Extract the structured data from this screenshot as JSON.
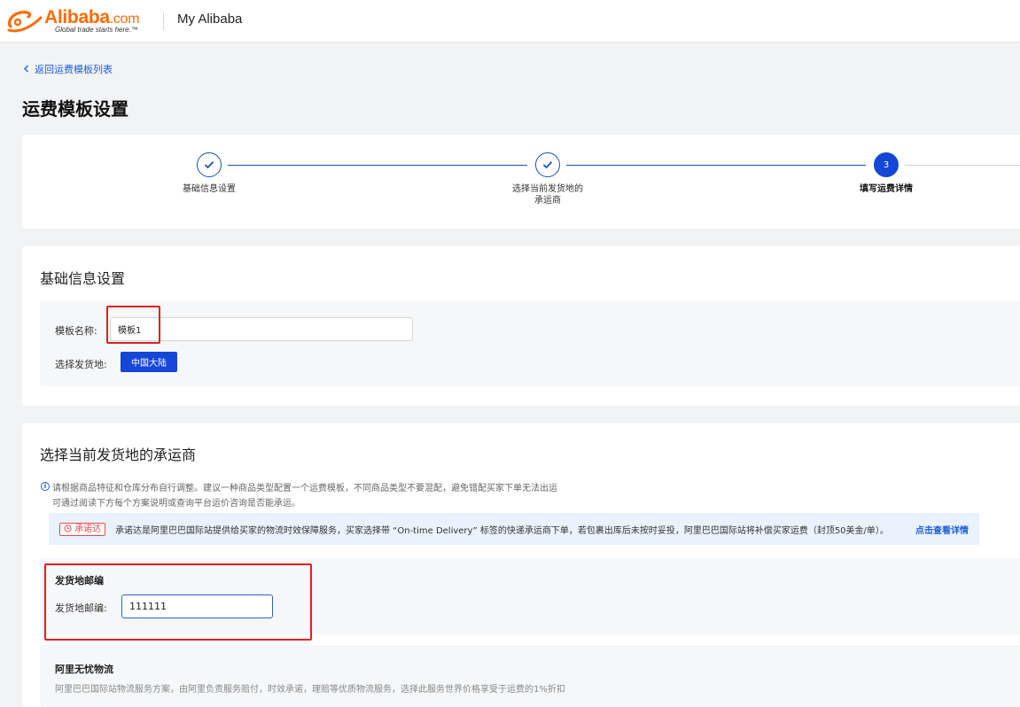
{
  "header": {
    "logo_text": "Alibaba",
    "logo_com": ".com",
    "logo_tagline": "Global trade starts here.™",
    "title": "My Alibaba"
  },
  "nav": {
    "back_label": "返回运费模板列表"
  },
  "page": {
    "title": "运费模板设置"
  },
  "steps": [
    {
      "label": "基础信息设置",
      "status": "done"
    },
    {
      "label": "选择当前发货地的",
      "label2": "承运商",
      "status": "done"
    },
    {
      "label": "填写运费详情",
      "number": "3",
      "status": "active"
    }
  ],
  "basic": {
    "title": "基础信息设置",
    "template_name_label": "模板名称:",
    "template_name_value": "模板1",
    "origin_label": "选择发货地:",
    "origin_value": "中国大陆"
  },
  "carrier": {
    "title": "选择当前发货地的承运商",
    "info_line1": "请根据商品特征和仓库分布自行调整。建议一种商品类型配置一个运费模板，不同商品类型不要混配，避免错配买家下单无法出运",
    "info_line2": "可通过阅读下方每个方案说明或查询平台运价咨询是否能承运。",
    "promise_badge": "承诺达",
    "promise_text": "承诺达是阿里巴巴国际站提供给买家的物流时效保障服务，买家选择带 “On-time Delivery” 标签的快递承运商下单，若包裹出库后未按时妥投，阿里巴巴国际站将补偿买家运费（封顶50美金/单）。",
    "promise_link": "点击查看详情",
    "postal_section_title": "发货地邮编",
    "postal_label": "发货地邮编:",
    "postal_value": "111111",
    "worry_free_title": "阿里无忧物流",
    "worry_free_desc": "阿里巴巴国际站物流服务方案，由阿里负责服务赔付，时效承诺，理赔等优质物流服务，选择此服务世界价格享受于运费的1%折扣"
  },
  "colors": {
    "brand_orange": "#ff6a00",
    "primary_blue": "#1547d6",
    "link_blue": "#1a5fd8",
    "highlight_red": "#e02020"
  }
}
